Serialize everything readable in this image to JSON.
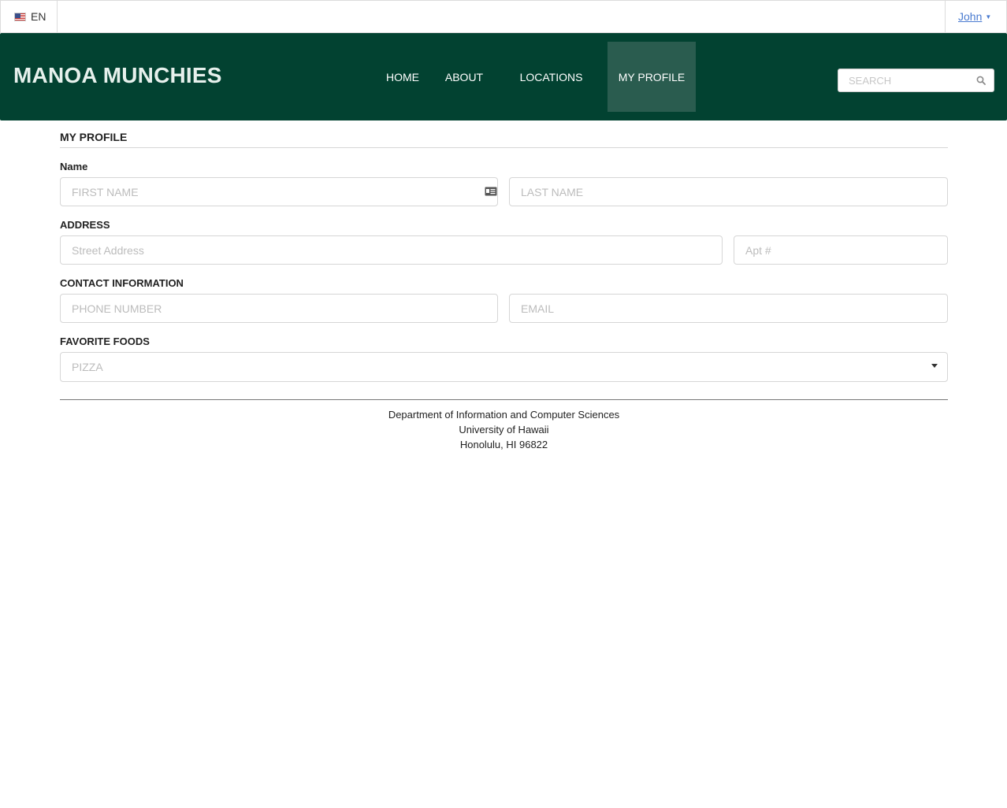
{
  "topbar": {
    "language": "EN",
    "user": "John"
  },
  "nav": {
    "brand": "MANOA MUNCHIES",
    "items": [
      {
        "label": "HOME"
      },
      {
        "label": "ABOUT"
      },
      {
        "label": "LOCATIONS"
      },
      {
        "label": "MY PROFILE",
        "active": true
      }
    ],
    "search_placeholder": "SEARCH"
  },
  "profile": {
    "title": "MY PROFILE",
    "name_label": "Name",
    "first_name_placeholder": "FIRST NAME",
    "last_name_placeholder": "LAST NAME",
    "address_label": "ADDRESS",
    "street_placeholder": "Street Address",
    "apt_placeholder": "Apt #",
    "contact_label": "CONTACT INFORMATION",
    "phone_placeholder": "PHONE NUMBER",
    "email_placeholder": "EMAIL",
    "foods_label": "FAVORITE FOODS",
    "foods_selected": "PIZZA"
  },
  "footer": {
    "line1": "Department of Information and Computer Sciences",
    "line2": "University of Hawaii",
    "line3": "Honolulu, HI 96822"
  },
  "colors": {
    "nav_bg": "#024231",
    "nav_active_bg": "#2a5c4f",
    "link": "#4a7bd0"
  }
}
